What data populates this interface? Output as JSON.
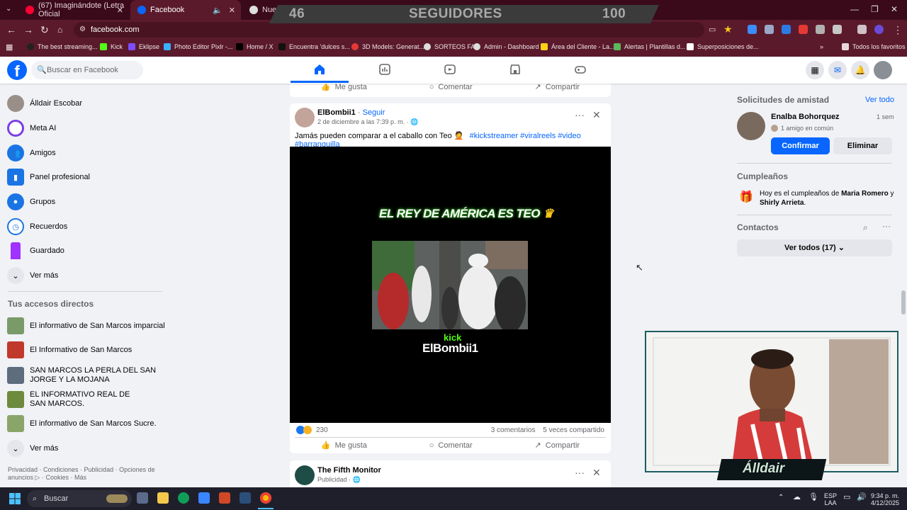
{
  "browser": {
    "tabs": [
      {
        "title": "(67) Imaginándote (Letra Oficial",
        "icon": "youtube-icon",
        "active": false
      },
      {
        "title": "Facebook",
        "icon": "facebook-icon",
        "active": true
      },
      {
        "title": "Nue",
        "icon": "github-icon",
        "active": false
      }
    ],
    "overlay": {
      "left_number": "46",
      "label": "SEGUIDORES",
      "right_number": "100"
    },
    "address": "facebook.com",
    "bookmarks": [
      "The best streaming...",
      "Kick",
      "Eklipse",
      "Photo Editor Pixlr -...",
      "Home / X",
      "Encuentra 'dulces s...",
      "3D Models: Generat...",
      "SORTEOS FA",
      "Admin - Dashboard",
      "Área del Cliente - La...",
      "Alertas | Plantillas d...",
      "Superposiciones de..."
    ],
    "all_bookmarks": "Todos los favoritos"
  },
  "facebook": {
    "search_placeholder": "Buscar en Facebook",
    "sidebar": {
      "items": [
        {
          "label": "Álldair Escobar",
          "icon": "profile-avatar"
        },
        {
          "label": "Meta AI",
          "icon": "meta-ai-icon"
        },
        {
          "label": "Amigos",
          "icon": "friends-icon"
        },
        {
          "label": "Panel profesional",
          "icon": "dashboard-icon"
        },
        {
          "label": "Grupos",
          "icon": "groups-icon"
        },
        {
          "label": "Recuerdos",
          "icon": "memories-icon"
        },
        {
          "label": "Guardado",
          "icon": "saved-icon"
        },
        {
          "label": "Ver más",
          "icon": "chevron-down-icon"
        }
      ],
      "shortcuts_title": "Tus accesos directos",
      "shortcuts": [
        "El informativo de San Marcos imparcial",
        "El Informativo de San Marcos",
        "SAN MARCOS LA PERLA DEL SAN JORGE Y LA MOJANA",
        "EL INFORMATIVO REAL DE SAN MARCOS.",
        "El informativo de San Marcos Sucre."
      ],
      "shortcuts_more": "Ver más",
      "footer": "Privacidad · Condiciones · Publicidad · Opciones de anuncios ▷ · Cookies · Más"
    },
    "feed": {
      "actions": {
        "like": "Me gusta",
        "comment": "Comentar",
        "share": "Compartir"
      },
      "post": {
        "author": "ElBombii1",
        "follow": "Seguir",
        "date": "2 de diciembre a las 7:39 p. m. ·",
        "text": "Jamás pueden comparar a el caballo con Teo 🤦",
        "hashtags": "#kickstreamer #viralreels #video #barranquilla",
        "video_title": "EL REY DE AMÉRICA ES TEO",
        "video_brand": "kick",
        "video_name": "ElBombii1",
        "reactions": "230",
        "comments": "3 comentarios",
        "shares": "5 veces compartido"
      },
      "next_post": {
        "author": "The Fifth Monitor",
        "subtitle": "Publicidad ·"
      }
    },
    "right": {
      "friend_requests": {
        "title": "Solicitudes de amistad",
        "see_all": "Ver todo",
        "name": "Enalba Bohorquez",
        "time": "1 sem",
        "mutual": "1 amigo en común",
        "confirm": "Confirmar",
        "delete": "Eliminar"
      },
      "birthdays": {
        "title": "Cumpleaños",
        "prefix": "Hoy es el cumpleaños de ",
        "name1": "Maria Romero",
        "and": " y ",
        "name2": "Shirly Arrieta",
        "suffix": "."
      },
      "contacts": {
        "title": "Contactos",
        "see_all": "Ver todos (17)"
      }
    }
  },
  "webcam": {
    "overlay_name": "Álldair"
  },
  "taskbar": {
    "search": "Buscar",
    "lang_top": "ESP",
    "lang_bottom": "LAA",
    "time": "9:34 p. m.",
    "date": "4/12/2025"
  }
}
